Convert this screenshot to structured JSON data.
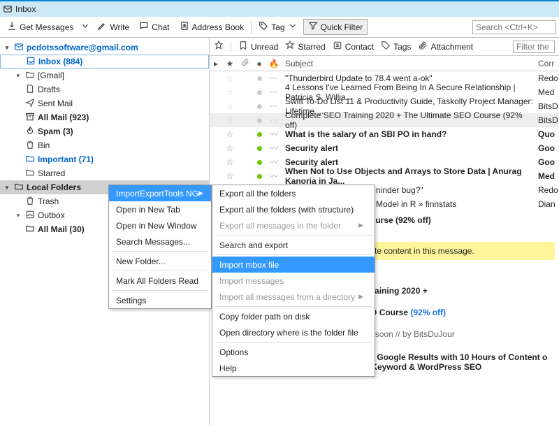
{
  "title": "Inbox",
  "toolbar": {
    "get_messages": "Get Messages",
    "write": "Write",
    "chat": "Chat",
    "address_book": "Address Book",
    "tag": "Tag",
    "quick_filter": "Quick Filter",
    "search_placeholder": "Search <Ctrl+K>"
  },
  "sidebar": {
    "account": "pcdotssoftware@gmail.com",
    "inbox": "Inbox (884)",
    "gmail": "[Gmail]",
    "drafts": "Drafts",
    "sent": "Sent Mail",
    "all_mail": "All Mail (923)",
    "spam": "Spam (3)",
    "bin": "Bin",
    "important": "Important (71)",
    "starred": "Starred",
    "local": "Local Folders",
    "trash": "Trash",
    "outbox": "Outbox",
    "all_mail_local": "All Mail (30)"
  },
  "filterbar": {
    "unread": "Unread",
    "starred": "Starred",
    "contact": "Contact",
    "tags": "Tags",
    "attachment": "Attachment",
    "filter_placeholder": "Filter the"
  },
  "columns": {
    "subject": "Subject",
    "corr": "Corr"
  },
  "messages": [
    {
      "subject": "\"Thunderbird Update to 78.4 went a-ok\"",
      "corr": "Redo",
      "bold": false,
      "green": false
    },
    {
      "subject": "4 Lessons I've Learned From Being In A Secure Relationship | Patricia S. Willia...",
      "corr": "Med",
      "bold": false,
      "green": false
    },
    {
      "subject": "Swift To-Do List 11 & Productivity Guide, Taskolly Project Manager: Lifetime ...",
      "corr": "BitsD",
      "bold": false,
      "green": false
    },
    {
      "subject": "Complete SEO Training 2020 + The Ultimate SEO Course (92% off)",
      "corr": "BitsD",
      "bold": false,
      "green": false,
      "sel": true
    },
    {
      "subject": "What is the salary of an SBI PO in hand?",
      "corr": "Quo",
      "bold": true,
      "green": true
    },
    {
      "subject": "Security alert",
      "corr": "Goo",
      "bold": true,
      "green": true
    },
    {
      "subject": "Security alert",
      "corr": "Goo",
      "bold": true,
      "green": true
    },
    {
      "subject": "When Not to Use Objects and Arrays to Store Data | Anurag Kanoria in Ja...",
      "corr": "Med",
      "bold": true,
      "green": true
    }
  ],
  "extra_rows": [
    {
      "text": "ninder bug?\"",
      "corr": "Redo"
    },
    {
      "text": "Model in R » finnstats",
      "corr": "Dian"
    }
  ],
  "ctx1": [
    {
      "label": "ImportExportTools NG",
      "hl": true,
      "sub": true
    },
    {
      "label": "Open in New Tab"
    },
    {
      "label": "Open in New Window"
    },
    {
      "label": "Search Messages..."
    },
    {
      "sep": true
    },
    {
      "label": "New Folder..."
    },
    {
      "sep": true
    },
    {
      "label": "Mark All Folders Read"
    },
    {
      "sep": true
    },
    {
      "label": "Settings"
    }
  ],
  "ctx2": [
    {
      "label": "Export all the folders"
    },
    {
      "label": "Export all the folders (with structure)"
    },
    {
      "label": "Export all messages in the folder",
      "dis": true,
      "sub": true
    },
    {
      "sep": true
    },
    {
      "label": "Search and export"
    },
    {
      "sep": true
    },
    {
      "label": "Import mbox file",
      "hl": true
    },
    {
      "label": "Import messages",
      "dis": true
    },
    {
      "label": "Import all messages from a directory",
      "dis": true,
      "sub": true
    },
    {
      "sep": true
    },
    {
      "label": "Copy folder path on disk"
    },
    {
      "label": "Open directory where is the folder file"
    },
    {
      "sep": true
    },
    {
      "label": "Options"
    },
    {
      "label": "Help"
    }
  ],
  "preview": {
    "subj_suffix": "ate SEO Course (92% off)",
    "notice": "cked remote content in this message.",
    "big1": "lete SEO Training 2020 +",
    "big2": "ltimate SEO Course ",
    "big_blue": "(92% off)",
    "ending": "Ending soon  //  by BitsDuJour",
    "desc": "Rank #1 on Google Results with 10 Hours of Content o",
    "desc2": "Backlinks  Keyword & WordPress SEO"
  }
}
